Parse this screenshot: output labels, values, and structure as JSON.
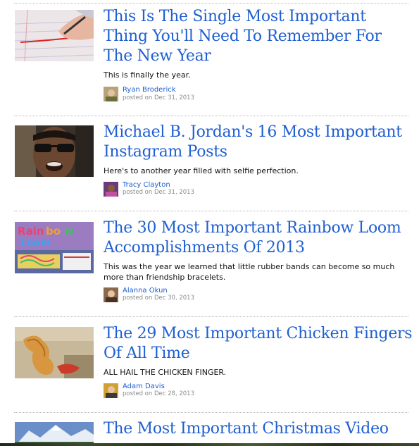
{
  "articles": [
    {
      "title": "This Is The Single Most Important Thing You'll Need To Remember For The New Year",
      "summary": "This is finally the year.",
      "author": "Ryan Broderick",
      "posted": "posted on Dec 31, 2013",
      "thumb_icon": "hand-writing-on-paper-thumbnail"
    },
    {
      "title": "Michael B. Jordan's 16 Most Important Instagram Posts",
      "summary": "Here's to another year filled with selfie perfection.",
      "author": "Tracy Clayton",
      "posted": "posted on Dec 31, 2013",
      "thumb_icon": "man-in-sunglasses-thumbnail"
    },
    {
      "title": "The 30 Most Important Rainbow Loom Accomplishments Of 2013",
      "summary": "This was the year we learned that little rubber bands can become so much more than friendship bracelets.",
      "author": "Alanna Okun",
      "posted": "posted on Dec 30, 2013",
      "thumb_icon": "rainbow-loom-box-thumbnail",
      "thumb_text": "Rainbow Loom"
    },
    {
      "title": "The 29 Most Important Chicken Fingers Of All Time",
      "summary": "ALL HAIL THE CHICKEN FINGER.",
      "author": "Adam Davis",
      "posted": "posted on Dec 28, 2013",
      "thumb_icon": "chicken-finger-thumbnail"
    },
    {
      "title": "The Most Important Christmas Video",
      "thumb_icon": "snowy-mountain-thumbnail"
    }
  ]
}
